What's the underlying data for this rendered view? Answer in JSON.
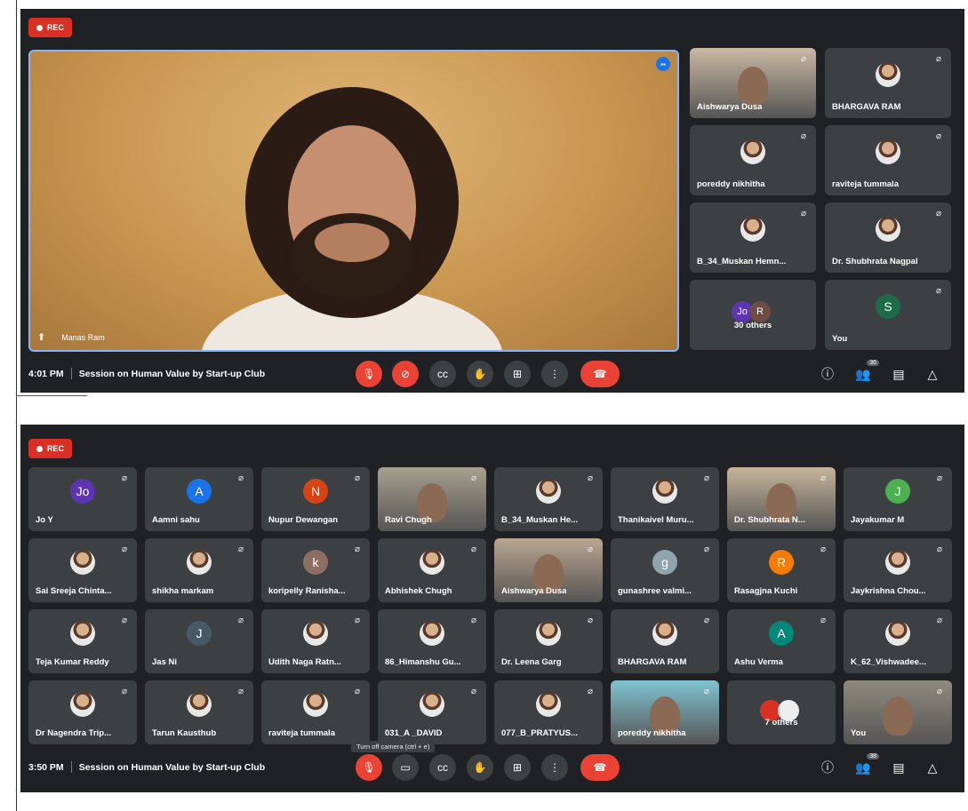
{
  "screen1": {
    "rec_label": "REC",
    "main_speaker_name": "Manas Ram",
    "time": "4:01 PM",
    "meeting_title": "Session on Human Value by Start-up Club",
    "participant_badge": "36",
    "tiles": [
      {
        "name": "Aishwarya Dusa",
        "kind": "video",
        "bg": "#c9b8a4"
      },
      {
        "name": "BHARGAVA RAM",
        "kind": "photo"
      },
      {
        "name": "poreddy nikhitha",
        "kind": "photo"
      },
      {
        "name": "raviteja tummala",
        "kind": "photo"
      },
      {
        "name": "B_34_Muskan Hemn...",
        "kind": "photo"
      },
      {
        "name": "Dr. Shubhrata Nagpal",
        "kind": "photo"
      },
      {
        "name": "30 others",
        "kind": "others",
        "avatars": [
          {
            "letter": "Jo",
            "color": "#5e35b1"
          },
          {
            "letter": "R",
            "color": "#6d4c41"
          }
        ]
      },
      {
        "name": "You",
        "kind": "letter",
        "letter": "S",
        "color": "#1e6b4a"
      }
    ]
  },
  "screen2": {
    "rec_label": "REC",
    "time": "3:50 PM",
    "meeting_title": "Session on Human Value by Start-up Club",
    "participant_badge": "38",
    "tooltip": "Turn off camera (ctrl + e)",
    "tiles": [
      {
        "name": "Jo Y",
        "kind": "letter",
        "letter": "Jo",
        "color": "#5e35b1"
      },
      {
        "name": "Aamni sahu",
        "kind": "letter",
        "letter": "A",
        "color": "#1a73e8"
      },
      {
        "name": "Nupur Dewangan",
        "kind": "letter",
        "letter": "N",
        "color": "#d84315"
      },
      {
        "name": "Ravi Chugh",
        "kind": "video",
        "bg": "#a7a08e"
      },
      {
        "name": "B_34_Muskan He...",
        "kind": "photo"
      },
      {
        "name": "Thanikaivel Muru...",
        "kind": "photo"
      },
      {
        "name": "Dr. Shubhrata N...",
        "kind": "video",
        "bg": "#c6b49a"
      },
      {
        "name": "Jayakumar M",
        "kind": "letter",
        "letter": "J",
        "color": "#4caf50"
      },
      {
        "name": "Sai Sreeja Chinta...",
        "kind": "photo"
      },
      {
        "name": "shikha markam",
        "kind": "photo"
      },
      {
        "name": "koripelly Ranisha...",
        "kind": "letter",
        "letter": "k",
        "color": "#8d6e63"
      },
      {
        "name": "Abhishek Chugh",
        "kind": "photo"
      },
      {
        "name": "Aishwarya Dusa",
        "kind": "video",
        "bg": "#b9a690"
      },
      {
        "name": "gunashree valmi...",
        "kind": "letter",
        "letter": "g",
        "color": "#90a4ae"
      },
      {
        "name": "Rasagjna Kuchi",
        "kind": "letter",
        "letter": "R",
        "color": "#f57c00"
      },
      {
        "name": "Jaykrishna Chou...",
        "kind": "photo"
      },
      {
        "name": "Teja Kumar Reddy",
        "kind": "photo"
      },
      {
        "name": "Jas Ni",
        "kind": "letter",
        "letter": "J",
        "color": "#455a64"
      },
      {
        "name": "Udith Naga Ratn...",
        "kind": "photo"
      },
      {
        "name": "86_Himanshu Gu...",
        "kind": "photo"
      },
      {
        "name": "Dr. Leena Garg",
        "kind": "photo"
      },
      {
        "name": "BHARGAVA RAM",
        "kind": "photo"
      },
      {
        "name": "Ashu Verma",
        "kind": "letter",
        "letter": "A",
        "color": "#00897b"
      },
      {
        "name": "K_62_Vishwadee...",
        "kind": "photo"
      },
      {
        "name": "Dr Nagendra Trip...",
        "kind": "photo"
      },
      {
        "name": "Tarun Kausthub",
        "kind": "photo"
      },
      {
        "name": "raviteja tummala",
        "kind": "photo"
      },
      {
        "name": "031_A _DAVID",
        "kind": "photo"
      },
      {
        "name": "077_B_PRATYUS...",
        "kind": "photo"
      },
      {
        "name": "poreddy nikhitha",
        "kind": "video",
        "bg": "#7fc3d1"
      },
      {
        "name": "7 others",
        "kind": "others",
        "avatars": [
          {
            "letter": "",
            "color": "#d93025"
          },
          {
            "letter": "",
            "color": "#eeeeee"
          }
        ]
      },
      {
        "name": "You",
        "kind": "video",
        "bg": "#8f8a80"
      }
    ]
  },
  "icons": {
    "mic_off": "mic-off-icon",
    "cam_off": "camera-off-icon",
    "captions": "captions-icon",
    "raise_hand": "raise-hand-icon",
    "present": "present-icon",
    "more": "more-options-icon",
    "end_call": "end-call-icon",
    "info": "info-icon",
    "people": "people-icon",
    "chat": "chat-icon",
    "activities": "activities-icon"
  }
}
